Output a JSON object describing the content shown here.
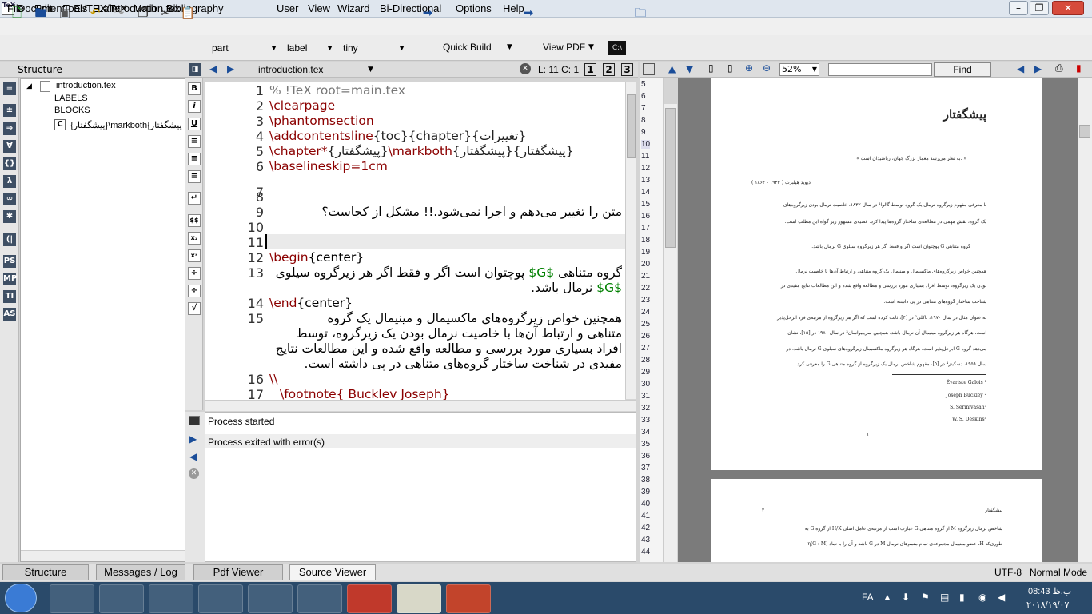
{
  "window": {
    "app_icon": "TeX",
    "title": "Document : E:/TEX/introduction.tex",
    "controls": [
      "minimize-icon",
      "restore-icon",
      "close-icon"
    ]
  },
  "menu": [
    "File",
    "Edit",
    "Tools",
    "LaTeX",
    "Math",
    "Bibliography",
    "User",
    "View",
    "Wizard",
    "Bi-Directional",
    "Options",
    "Help"
  ],
  "toolbar": {
    "combos": {
      "part": "part",
      "label": "label",
      "size": "tiny"
    },
    "quick_build": "Quick Build",
    "view_pdf": "View PDF"
  },
  "structure": {
    "title": "Structure",
    "file": "introduction.tex",
    "labels": "LABELS",
    "blocks": "BLOCKS",
    "section": "{پیشگفتار}\\markboth{پیشگفتار"
  },
  "editor": {
    "filename": "introduction.tex",
    "position": "L: 11 C: 1",
    "split_buttons": [
      "1",
      "2",
      "3"
    ],
    "line_numbers": [
      "1",
      "2",
      "3",
      "4",
      "5",
      "6",
      "7",
      "8",
      "9",
      "10",
      "11",
      "12",
      "13",
      "14",
      "15",
      "16",
      "17"
    ],
    "lines": {
      "l1": "% !TeX root=main.tex",
      "l2": "\\clearpage",
      "l3": "\\phantomsection",
      "l4_cmd": "\\addcontentsline",
      "l4_args": "{toc}{chapter}{تغییرات}",
      "l5_cmd": "\\chapter*",
      "l5_arg1": "{پیشگفتار}",
      "l5_cmd2": "\\markboth",
      "l5_arg2": "{پیشگفتار}{پیشگفتار}",
      "l6": "\\baselineskip=1cm",
      "l9": "متن را تغییر می‌دهم و اجرا نمی‌شود.!! مشکل از کجاست؟",
      "l12_cmd": "\\begin",
      "l12_arg": "{center}",
      "l13a_pre": "گروه متناهی",
      "l13a_math": "$G$",
      "l13a_post": "پوچتوان است اگر و فقط اگر هر زیرگروه سیلوی",
      "l13b_math": "$G$",
      "l13b_post": "نرمال باشد.",
      "l14_cmd": "\\end",
      "l14_arg": "{center}",
      "l15a": "همچنین خواص زیرگروه‌های ماکسیمال و مینیمال یک گروه",
      "l15b": "متناهی و ارتباط آن‌ها با خاصیت نرمال بودن یک زیرگروه، توسط",
      "l15c": "افراد بسیاری مورد بررسی و مطالعه واقع شده و این مطالعات نتایج",
      "l15d": "مفیدی در شناخت ساختار گروه‌های متناهی در پی داشته است.",
      "l16": "\\\\",
      "l17": "\\footnote{ Bucklev Joseph}"
    }
  },
  "messages": {
    "line1": "Process started",
    "line2": "Process exited with error(s)"
  },
  "pdf": {
    "zoom": "52%",
    "find_button": "Find",
    "sync_line_numbers": [
      "5",
      "6",
      "7",
      "8",
      "9",
      "10",
      "11",
      "12",
      "13",
      "14",
      "15",
      "16",
      "17",
      "18",
      "19",
      "20",
      "21",
      "22",
      "23",
      "24",
      "25",
      "26",
      "27",
      "28",
      "29",
      "30",
      "31",
      "32",
      "33",
      "34",
      "35",
      "36",
      "37",
      "38",
      "39",
      "40",
      "41",
      "42",
      "43",
      "44"
    ],
    "page1": {
      "heading": "پیشگفتار",
      "quote": "« به نظر می‌رسد معمار بزرگ جهان، ریاضیدان است. »",
      "attribution": "دیوید هیلبرت ( ۱۹۴۳ - ۱۸۶۲ )",
      "p1a": "با معرفی مفهوم زیرگروه نرمال یک گروه توسط گالوا¹ در سال ۱۸۳۲، خاصیت نرمال بودن زیرگروه‌های",
      "p1b": "یک گروه، نقش مهمی در مطالعه‌ی ساختار گروه‌ها پیدا کرد. قضیه‌ی مشهور زیر گواه این مطلب است.",
      "theorem": "گروه متناهی G پوچتوان است اگر و فقط اگر هر زیرگروه سیلوی G نرمال باشد.",
      "p2a": "همچنین خواص زیرگروه‌های ماکسیمال و مینیمال یک گروه متناهی و ارتباط آن‌ها با خاصیت نرمال",
      "p2b": "بودن یک زیرگروه، توسط افراد بسیاری مورد بررسی و مطالعه واقع شده و این مطالعات نتایج مفیدی در",
      "p2c": "شناخت ساختار گروه‌های متناهی در پی داشته است.",
      "p3a": "به عنوان مثال در سال ۱۹۷۰، باکلی² در [۴]، ثابت کرده است که اگر هر زیرگروه از مرتبه‌ی فرد ابرحل‌پذیر",
      "p3b": "است، هرگاه هر زیرگروه مینیمال آن نرمال باشد. همچنین سرینیواسان³ در سال ۱۹۸۰ در [۱۵]، نشان",
      "p3c": "می‌دهد گروه G ابرحل‌پذیر است، هرگاه هر زیرگروه ماکسیمال زیرگروه‌های سیلوی G نرمال باشد. در",
      "p3d": "سال ۱۹۵۹، دسکینز⁴ در [۵]، مفهوم شاخص نرمال یک زیرگروه از گروه متناهی G را معرفی کرد.",
      "fn1": "Évariste Galois ¹",
      "fn2": "Joseph Buckley ²",
      "fn3": "S. Serinivasan³",
      "fn4": "W. S. Deskins⁴",
      "page_number": "۱"
    },
    "page2": {
      "page_number": "۲",
      "header": "پیشگفتار",
      "l1": "شاخص نرمال زیرگروه M از گروه متناهی G عبارت است از مرتبه‌ی عامل اصلی H/K از گروه G به",
      "l2": "طوری‌که H، عضو مینیمال مجموعه‌ی تمام متمم‌های نرمال M در G باشد و آن را با نماد (G : M)η"
    }
  },
  "tabs": [
    "Structure",
    "Messages / Log",
    "Pdf Viewer",
    "Source Viewer"
  ],
  "status": {
    "encoding": "UTF-8",
    "mode": "Normal Mode"
  },
  "taskbar": {
    "lang": "FA",
    "time": "08:43 ب.ظ",
    "date": "۲۰۱۸/۱۹/۰۷"
  }
}
